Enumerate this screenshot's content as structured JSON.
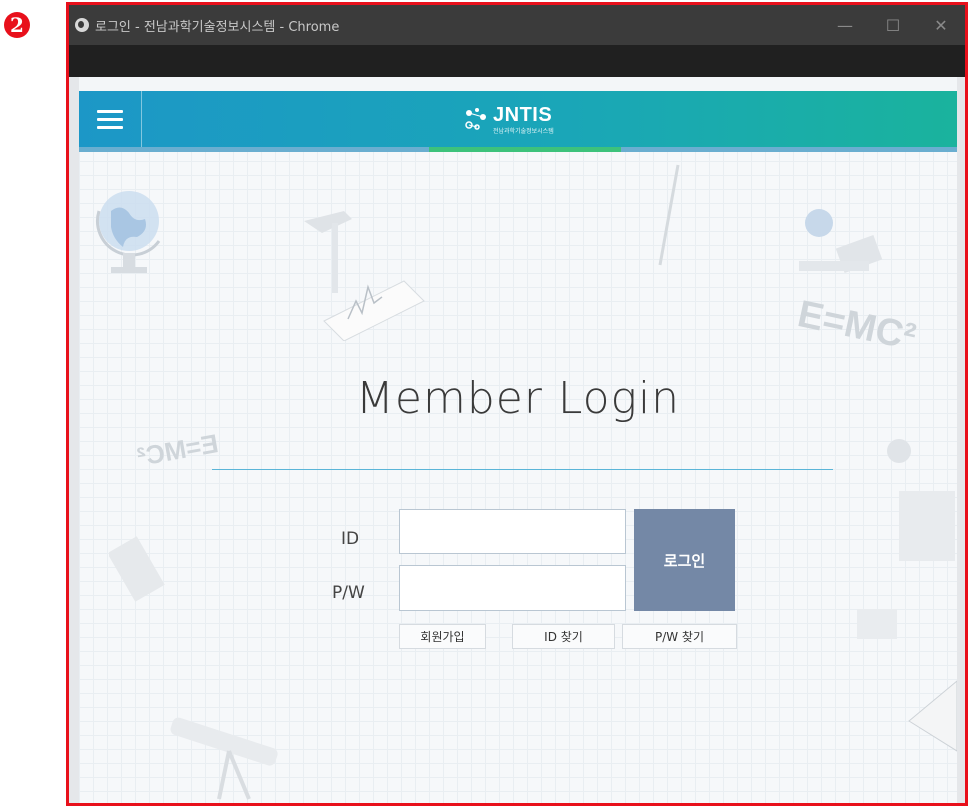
{
  "step_badge": "2",
  "window": {
    "title": "로그인 - 전남과학기술정보시스템 - Chrome",
    "controls": {
      "minimize": "—",
      "maximize": "☐",
      "close": "✕"
    }
  },
  "header": {
    "logo_text": "JNTIS",
    "logo_subtext": "전남과학기술정보시스템"
  },
  "background_text": {
    "formula": "E=MC²",
    "formula_mirrored": "E=MC²"
  },
  "login": {
    "title": "Member Login",
    "id_label": "ID",
    "pw_label": "P/W",
    "id_value": "",
    "pw_value": "",
    "submit_label": "로그인",
    "signup_label": "회원가입",
    "find_id_label": "ID 찾기",
    "find_pw_label": "P/W 찾기"
  },
  "colors": {
    "frame_border": "#e8101b",
    "header_start": "#1c97c7",
    "header_end": "#1ab39d",
    "accent_green": "#3dc27b",
    "login_button": "#7488a6"
  }
}
